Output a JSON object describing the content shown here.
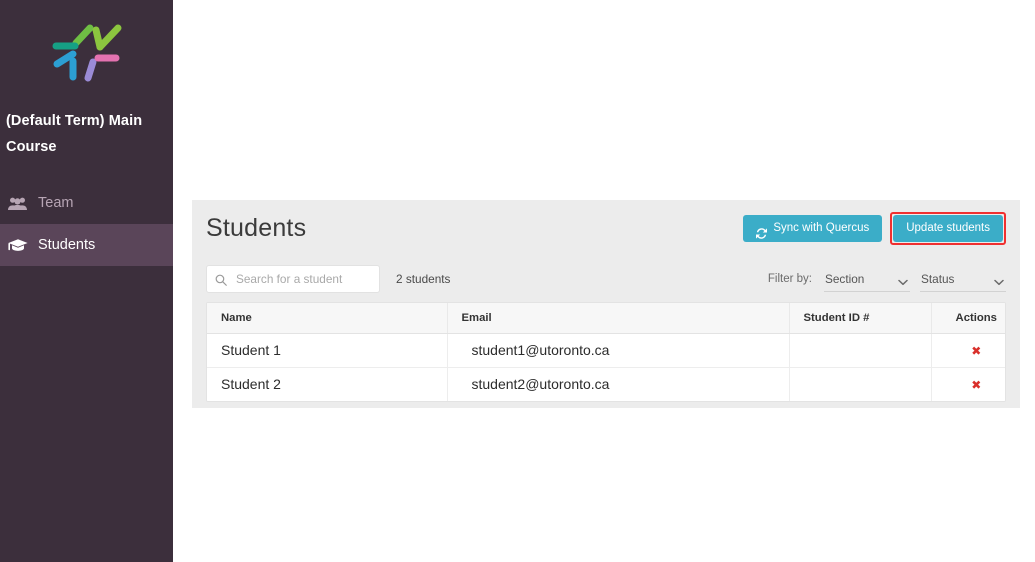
{
  "theme": {
    "sidebar_bg": "#3C2F3C",
    "sidebar_active_bg": "#5A4559",
    "accent_teal": "#3BADC8",
    "highlight_red": "#F03030",
    "delete_red": "#D9302B",
    "card_bg": "#ECECEC",
    "page_bg": "#FFFFFF"
  },
  "sidebar": {
    "logo_name": "markus-burst-logo",
    "course_title": "(Default Term) Main Course",
    "items": [
      {
        "label": "Team",
        "icon": "users-group-icon",
        "active": false
      },
      {
        "label": "Students",
        "icon": "graduation-cap-icon",
        "active": true
      }
    ]
  },
  "main": {
    "page_title": "Students",
    "buttons": {
      "sync_label": "Sync with Quercus",
      "sync_icon": "sync-refresh-icon",
      "update_label": "Update students",
      "update_highlighted": true
    },
    "search": {
      "placeholder": "Search for a student",
      "value": "",
      "icon": "search-icon"
    },
    "count_label": "2 students",
    "filter": {
      "label": "Filter by:",
      "selects": [
        {
          "name": "section",
          "value": "Section",
          "icon": "chevron-down-icon"
        },
        {
          "name": "status",
          "value": "Status",
          "icon": "chevron-down-icon"
        }
      ]
    },
    "table": {
      "columns": [
        "Name",
        "Email",
        "Student ID #",
        "Actions"
      ],
      "rows": [
        {
          "name": "Student 1",
          "email": "student1@utoronto.ca",
          "student_id": "",
          "action_icon": "delete-x-icon",
          "action_glyph": "✖"
        },
        {
          "name": "Student 2",
          "email": "student2@utoronto.ca",
          "student_id": "",
          "action_icon": "delete-x-icon",
          "action_glyph": "✖"
        }
      ]
    }
  }
}
